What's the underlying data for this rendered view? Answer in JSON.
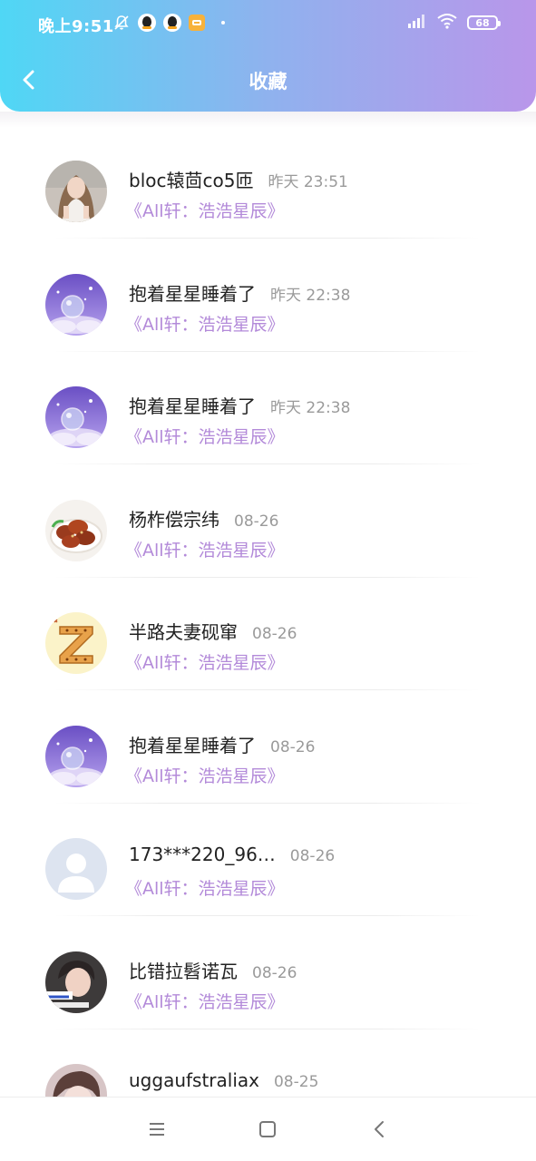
{
  "status_bar": {
    "time": "晚上9:51",
    "battery": "68"
  },
  "header": {
    "title": "收藏",
    "accent_start": "#4fd7f5",
    "accent_end": "#b996ea"
  },
  "favorites": [
    {
      "name": "bloc辕茴co5匝",
      "time": "昨天 23:51",
      "book": "《All轩：浩浩星辰》",
      "avatar": "girl-photo"
    },
    {
      "name": "抱着星星睡着了",
      "time": "昨天 22:38",
      "book": "《All轩：浩浩星辰》",
      "avatar": "purple-crystal-ball"
    },
    {
      "name": "抱着星星睡着了",
      "time": "昨天 22:38",
      "book": "《All轩：浩浩星辰》",
      "avatar": "purple-crystal-ball"
    },
    {
      "name": "杨柞偿宗纬",
      "time": "08-26",
      "book": "《All轩：浩浩星辰》",
      "avatar": "chicken-wings"
    },
    {
      "name": "半路夫妻砚窜",
      "time": "08-26",
      "book": "《All轩：浩浩星辰》",
      "avatar": "letter-z"
    },
    {
      "name": "抱着星星睡着了",
      "time": "08-26",
      "book": "《All轩：浩浩星辰》",
      "avatar": "purple-crystal-ball"
    },
    {
      "name": "173***220_96…",
      "time": "08-26",
      "book": "《All轩：浩浩星辰》",
      "avatar": "default-user"
    },
    {
      "name": "比错拉髫诺瓦",
      "time": "08-26",
      "book": "《All轩：浩浩星辰》",
      "avatar": "boy-photo"
    },
    {
      "name": "uggaufstraliax",
      "time": "08-25",
      "book": "",
      "avatar": "face-photo"
    }
  ],
  "colors": {
    "book_link": "#b38ad9",
    "time_text": "#9a9a9a",
    "name_text": "#222222"
  },
  "icons": {
    "back": "chevron-left-icon",
    "menu": "menu-icon",
    "home": "home-square-icon",
    "nav_back": "nav-back-icon"
  }
}
